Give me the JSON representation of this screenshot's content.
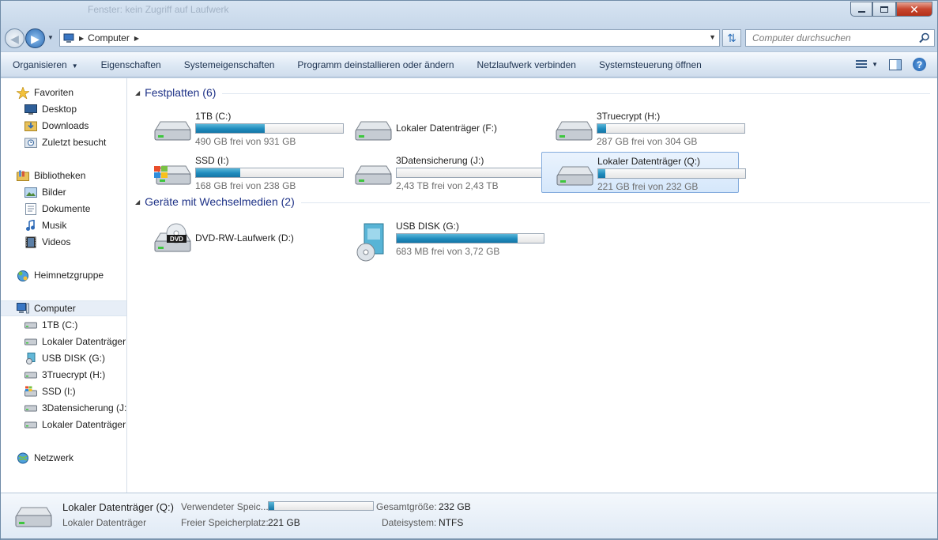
{
  "window": {
    "background_title": "Fenster: kein Zugriff auf Laufwerk"
  },
  "address": {
    "crumb": "Computer",
    "search_placeholder": "Computer durchsuchen"
  },
  "commands": {
    "organize": "Organisieren",
    "properties": "Eigenschaften",
    "system_properties": "Systemeigenschaften",
    "uninstall": "Programm deinstallieren oder ändern",
    "map_drive": "Netzlaufwerk verbinden",
    "control_panel": "Systemsteuerung öffnen"
  },
  "nav": {
    "favorites": "Favoriten",
    "desktop": "Desktop",
    "downloads": "Downloads",
    "recent": "Zuletzt besucht",
    "libraries": "Bibliotheken",
    "pictures": "Bilder",
    "documents": "Dokumente",
    "music": "Musik",
    "videos": "Videos",
    "homegroup": "Heimnetzgruppe",
    "computer": "Computer",
    "drives": [
      "1TB  (C:)",
      "Lokaler Datenträger",
      "USB DISK (G:)",
      "3Truecrypt (H:)",
      "SSD (I:)",
      "3Datensicherung (J:)",
      "Lokaler Datenträger"
    ],
    "network": "Netzwerk"
  },
  "groups": {
    "hard_disks": "Festplatten (6)",
    "removable": "Geräte mit Wechselmedien (2)"
  },
  "drives": [
    {
      "name": "1TB  (C:)",
      "free": "490 GB frei von 931 GB",
      "used_fraction": 0.47,
      "icon": "hard-drive-icon"
    },
    {
      "name": "Lokaler Datenträger (F:)",
      "free": "",
      "used_fraction": null,
      "icon": "hard-drive-icon"
    },
    {
      "name": "3Truecrypt (H:)",
      "free": "287 GB frei von 304 GB",
      "used_fraction": 0.06,
      "icon": "hard-drive-icon"
    },
    {
      "name": "SSD (I:)",
      "free": "168 GB frei von 238 GB",
      "used_fraction": 0.3,
      "icon": "windows-drive-icon"
    },
    {
      "name": "3Datensicherung (J:)",
      "free": "2,43 TB frei von 2,43 TB",
      "used_fraction": 0.0,
      "icon": "hard-drive-icon"
    },
    {
      "name": "Lokaler Datenträger (Q:)",
      "free": "221 GB frei von 232 GB",
      "used_fraction": 0.05,
      "icon": "hard-drive-icon"
    }
  ],
  "removable": [
    {
      "name": "DVD-RW-Laufwerk (D:)",
      "free": "",
      "used_fraction": null,
      "icon": "dvd-drive-icon"
    },
    {
      "name": "USB DISK (G:)",
      "free": "683 MB frei von 3,72 GB",
      "used_fraction": 0.82,
      "icon": "usb-disk-icon"
    }
  ],
  "details": {
    "name": "Lokaler Datenträger (Q:)",
    "type": "Lokaler Datenträger",
    "used_label": "Verwendeter Speic...",
    "used_fraction": 0.05,
    "free_label": "Freier Speicherplatz:",
    "free_value": "221 GB",
    "total_label": "Gesamtgröße:",
    "total_value": "232 GB",
    "fs_label": "Dateisystem:",
    "fs_value": "NTFS"
  },
  "colors": {
    "accent_fill": "#1f8bbd",
    "group_title": "#1e3287",
    "selection": "#d5e7fb"
  }
}
